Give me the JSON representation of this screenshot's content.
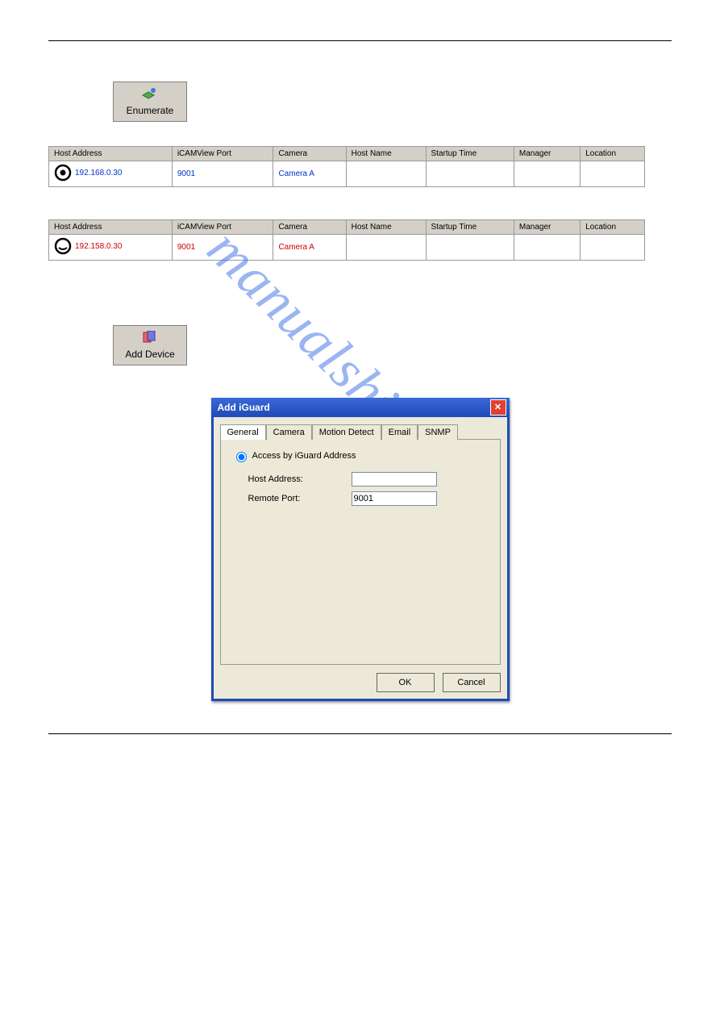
{
  "watermark": "manualshive.com",
  "buttons": {
    "enumerate": "Enumerate",
    "add_device": "Add Device"
  },
  "table1": {
    "headers": [
      "Host Address",
      "iCAMView Port",
      "Camera",
      "Host Name",
      "Startup Time",
      "Manager",
      "Location"
    ],
    "row": {
      "host": "192.168.0.30",
      "port": "9001",
      "cam": "Camera A",
      "hostname": "",
      "startup": "",
      "manager": "",
      "location": ""
    }
  },
  "table2": {
    "headers": [
      "Host Address",
      "iCAMView Port",
      "Camera",
      "Host Name",
      "Startup Time",
      "Manager",
      "Location"
    ],
    "row": {
      "host": "192.158.0.30",
      "port": "9001",
      "cam": "Camera A",
      "hostname": "",
      "startup": "",
      "manager": "",
      "location": ""
    }
  },
  "dialog": {
    "title": "Add iGuard",
    "tabs": [
      "General",
      "Camera",
      "Motion Detect",
      "Email",
      "SNMP"
    ],
    "radio_label": "Access by iGuard Address",
    "host_label": "Host Address:",
    "host_value": "",
    "port_label": "Remote Port:",
    "port_value": "9001",
    "ok": "OK",
    "cancel": "Cancel"
  }
}
